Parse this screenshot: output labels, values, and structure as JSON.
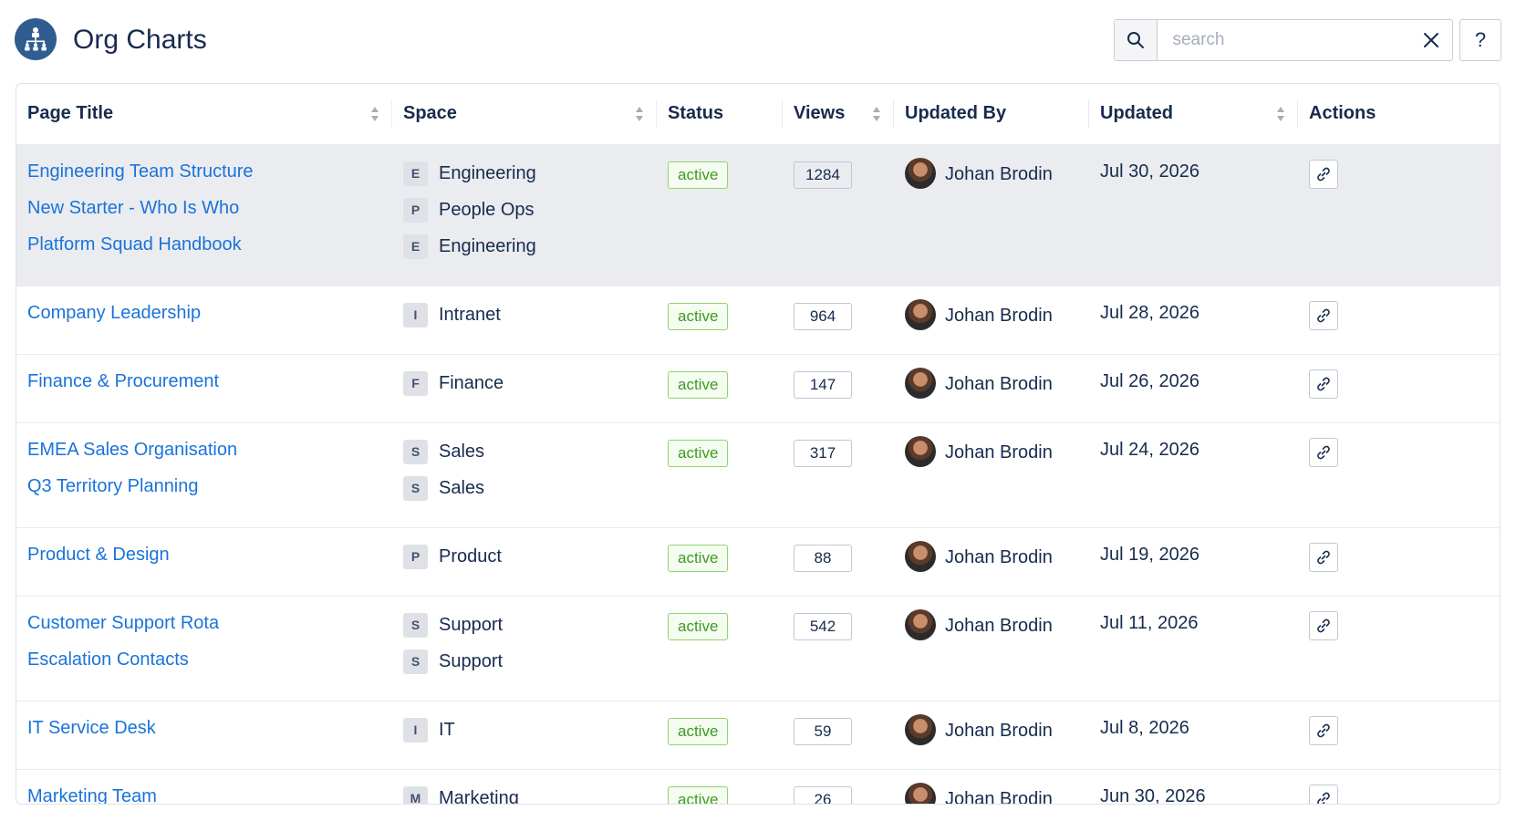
{
  "app": {
    "title": "Org Charts",
    "logo_icon": "org-chart-icon"
  },
  "search": {
    "placeholder": "search",
    "value": "",
    "help_label": "?"
  },
  "table": {
    "columns": [
      {
        "label": "Page Title",
        "sortable": true
      },
      {
        "label": "Space",
        "sortable": true
      },
      {
        "label": "Status",
        "sortable": false
      },
      {
        "label": "Views",
        "sortable": true
      },
      {
        "label": "Updated By",
        "sortable": false
      },
      {
        "label": "Updated",
        "sortable": true
      },
      {
        "label": "Actions",
        "sortable": false
      }
    ],
    "rows": [
      {
        "pages": [
          {
            "title": "Engineering Team Structure",
            "space_letter": "E",
            "space": "Engineering"
          },
          {
            "title": "New Starter - Who Is Who",
            "space_letter": "P",
            "space": "People Ops"
          },
          {
            "title": "Platform Squad Handbook",
            "space_letter": "E",
            "space": "Engineering"
          }
        ],
        "status": "active",
        "views": "1284",
        "updated_by": "Johan Brodin",
        "updated": "Jul 30, 2026",
        "highlighted": true
      },
      {
        "pages": [
          {
            "title": "Company Leadership",
            "space_letter": "I",
            "space": "Intranet"
          }
        ],
        "status": "active",
        "views": "964",
        "updated_by": "Johan Brodin",
        "updated": "Jul 28, 2026"
      },
      {
        "pages": [
          {
            "title": "Finance & Procurement",
            "space_letter": "F",
            "space": "Finance"
          }
        ],
        "status": "active",
        "views": "147",
        "updated_by": "Johan Brodin",
        "updated": "Jul 26, 2026"
      },
      {
        "pages": [
          {
            "title": "EMEA Sales Organisation",
            "space_letter": "S",
            "space": "Sales"
          },
          {
            "title": "Q3 Territory Planning",
            "space_letter": "S",
            "space": "Sales"
          }
        ],
        "status": "active",
        "views": "317",
        "updated_by": "Johan Brodin",
        "updated": "Jul 24, 2026"
      },
      {
        "pages": [
          {
            "title": "Product & Design",
            "space_letter": "P",
            "space": "Product"
          }
        ],
        "status": "active",
        "views": "88",
        "updated_by": "Johan Brodin",
        "updated": "Jul 19, 2026"
      },
      {
        "pages": [
          {
            "title": "Customer Support Rota",
            "space_letter": "S",
            "space": "Support"
          },
          {
            "title": "Escalation Contacts",
            "space_letter": "S",
            "space": "Support"
          }
        ],
        "status": "active",
        "views": "542",
        "updated_by": "Johan Brodin",
        "updated": "Jul 11, 2026"
      },
      {
        "pages": [
          {
            "title": "IT Service Desk",
            "space_letter": "I",
            "space": "IT"
          }
        ],
        "status": "active",
        "views": "59",
        "updated_by": "Johan Brodin",
        "updated": "Jul 8, 2026"
      },
      {
        "pages": [
          {
            "title": "Marketing Team",
            "space_letter": "M",
            "space": "Marketing"
          }
        ],
        "status": "active",
        "views": "26",
        "updated_by": "Johan Brodin",
        "updated": "Jun 30, 2026"
      }
    ]
  },
  "colors": {
    "link": "#1a73d9",
    "status_green": "#3d9b24",
    "highlight_row": "#ebecf0"
  }
}
